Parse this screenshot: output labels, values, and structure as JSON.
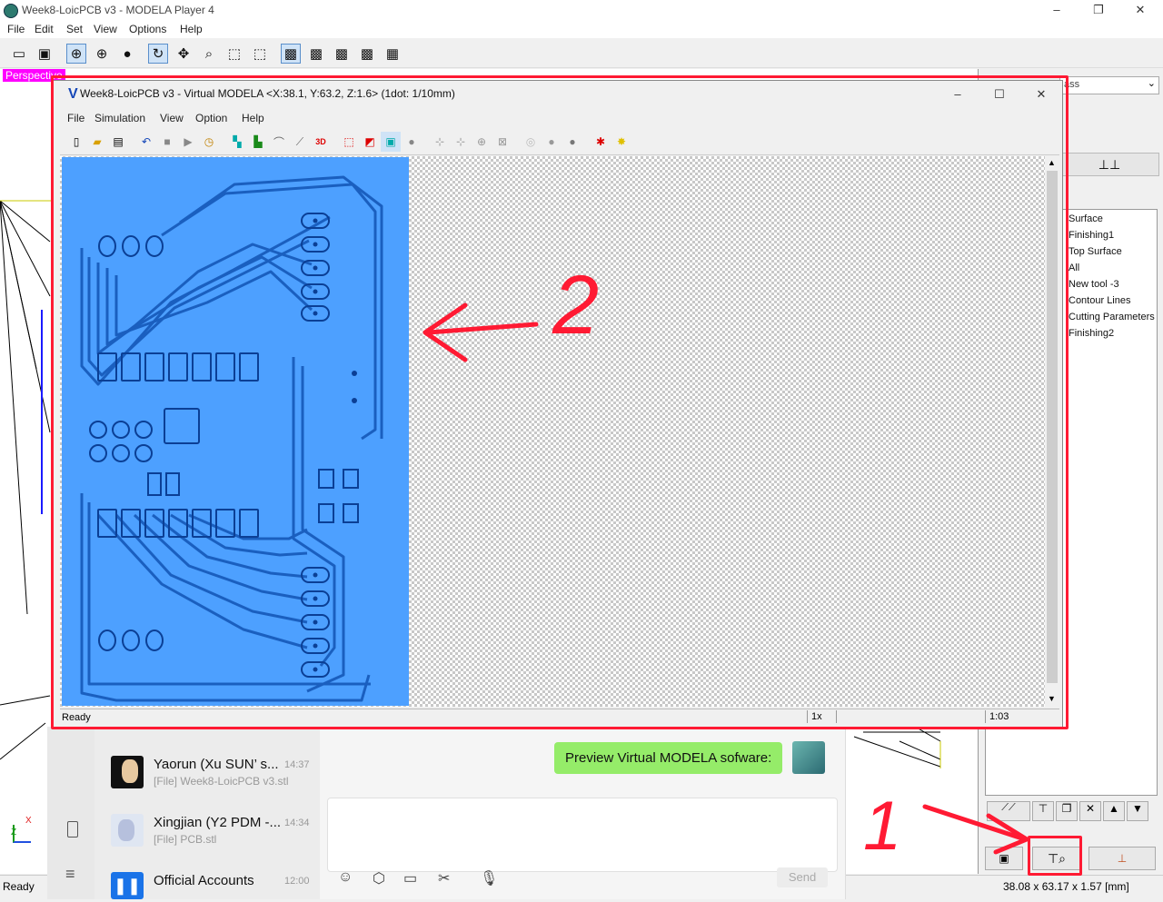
{
  "modela_player": {
    "title": "Week8-LoicPCB v3 - MODELA Player 4",
    "menu": [
      "File",
      "Edit",
      "Set",
      "View",
      "Options",
      "Help"
    ],
    "view_label": "Perspective",
    "status": "Ready",
    "dimensions": "38.08 x 63.17 x 1.57 [mm]",
    "material_value": "ass",
    "process_tree": [
      "Surface",
      "Finishing1",
      "Top Surface",
      "All",
      "New tool -3",
      "Contour Lines",
      "Cutting Parameters",
      "Finishing2"
    ],
    "axis_labels": {
      "z": "Z",
      "x": "X"
    }
  },
  "virtual_modela": {
    "title": "Week8-LoicPCB v3 - Virtual MODELA <X:38.1, Y:63.2, Z:1.6> (1dot: 1/10mm)",
    "menu": [
      "File",
      "Simulation",
      "View",
      "Option",
      "Help"
    ],
    "status": "Ready",
    "zoom": "1x",
    "time": "1:03"
  },
  "chat": {
    "contacts": [
      {
        "name": "Yaorun (Xu SUN’ s...",
        "time": "14:37",
        "sub": "[File] Week8-LoicPCB v3.stl"
      },
      {
        "name": "Xingjian (Y2 PDM -...",
        "time": "14:34",
        "sub": "[File] PCB.stl"
      },
      {
        "name": "Official Accounts",
        "time": "12:00",
        "sub": ""
      }
    ],
    "message": "Preview Virtual MODELA sofware:",
    "send_label": "Send"
  },
  "annotations": {
    "label_1": "1",
    "label_2": "2"
  },
  "colors": {
    "pcb_blue": "#4da0ff",
    "annotation_red": "#ff1a33",
    "perspective_magenta": "#ff00ff",
    "chat_bubble": "#95ec69"
  },
  "icons": [
    "open-icon",
    "save-icon",
    "globe-icon",
    "sphere-icon",
    "rotate-icon",
    "move-icon",
    "zoom-icon",
    "fit-icon",
    "cube-icon",
    "grid-icon"
  ]
}
